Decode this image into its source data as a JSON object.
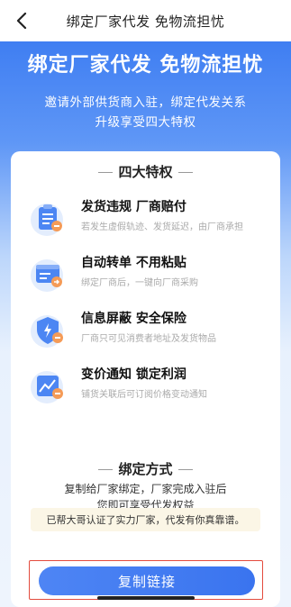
{
  "nav": {
    "title": "绑定厂家代发 免物流担忧"
  },
  "hero": {
    "headline": "绑定厂家代发 免物流担忧",
    "subtitle_line1": "邀请外部供货商入驻，绑定代发关系",
    "subtitle_line2": "升级享受四大特权"
  },
  "privileges": {
    "title": "四大特权",
    "items": [
      {
        "title": "发货违规  厂商赔付",
        "desc": "若发生虚假轨迹、发货延迟，由厂商承担",
        "icon": "clipboard-icon"
      },
      {
        "title": "自动转单  不用粘贴",
        "desc": "绑定厂商后，一键向厂商采购",
        "icon": "window-transfer-icon"
      },
      {
        "title": "信息屏蔽  安全保险",
        "desc": "厂商只可见消费者地址及发货物品",
        "icon": "shield-icon"
      },
      {
        "title": "变价通知  锁定利润",
        "desc": "铺货关联后可订阅价格变动通知",
        "icon": "price-chart-icon"
      }
    ]
  },
  "bind": {
    "title": "绑定方式",
    "desc_line1": "复制给厂家绑定，厂家完成入驻后",
    "desc_line2": "您即可享受代发权益",
    "notice": "已帮大哥认证了实力厂家，代发有你真靠谱。",
    "copy_label": "复制链接"
  },
  "colors": {
    "primary": "#3f7ef2",
    "highlight_border": "#e34b3d",
    "notice_bg": "#fbf6e6"
  }
}
